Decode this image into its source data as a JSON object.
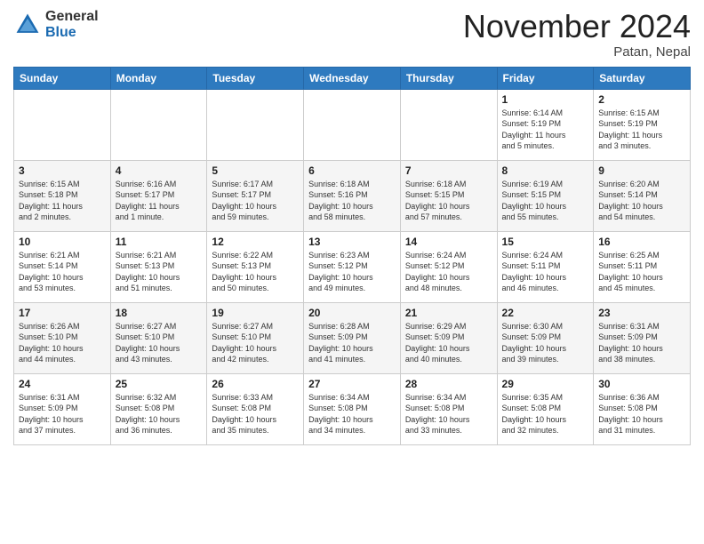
{
  "header": {
    "logo_general": "General",
    "logo_blue": "Blue",
    "month_title": "November 2024",
    "location": "Patan, Nepal"
  },
  "weekdays": [
    "Sunday",
    "Monday",
    "Tuesday",
    "Wednesday",
    "Thursday",
    "Friday",
    "Saturday"
  ],
  "weeks": [
    [
      {
        "day": "",
        "info": ""
      },
      {
        "day": "",
        "info": ""
      },
      {
        "day": "",
        "info": ""
      },
      {
        "day": "",
        "info": ""
      },
      {
        "day": "",
        "info": ""
      },
      {
        "day": "1",
        "info": "Sunrise: 6:14 AM\nSunset: 5:19 PM\nDaylight: 11 hours\nand 5 minutes."
      },
      {
        "day": "2",
        "info": "Sunrise: 6:15 AM\nSunset: 5:19 PM\nDaylight: 11 hours\nand 3 minutes."
      }
    ],
    [
      {
        "day": "3",
        "info": "Sunrise: 6:15 AM\nSunset: 5:18 PM\nDaylight: 11 hours\nand 2 minutes."
      },
      {
        "day": "4",
        "info": "Sunrise: 6:16 AM\nSunset: 5:17 PM\nDaylight: 11 hours\nand 1 minute."
      },
      {
        "day": "5",
        "info": "Sunrise: 6:17 AM\nSunset: 5:17 PM\nDaylight: 10 hours\nand 59 minutes."
      },
      {
        "day": "6",
        "info": "Sunrise: 6:18 AM\nSunset: 5:16 PM\nDaylight: 10 hours\nand 58 minutes."
      },
      {
        "day": "7",
        "info": "Sunrise: 6:18 AM\nSunset: 5:15 PM\nDaylight: 10 hours\nand 57 minutes."
      },
      {
        "day": "8",
        "info": "Sunrise: 6:19 AM\nSunset: 5:15 PM\nDaylight: 10 hours\nand 55 minutes."
      },
      {
        "day": "9",
        "info": "Sunrise: 6:20 AM\nSunset: 5:14 PM\nDaylight: 10 hours\nand 54 minutes."
      }
    ],
    [
      {
        "day": "10",
        "info": "Sunrise: 6:21 AM\nSunset: 5:14 PM\nDaylight: 10 hours\nand 53 minutes."
      },
      {
        "day": "11",
        "info": "Sunrise: 6:21 AM\nSunset: 5:13 PM\nDaylight: 10 hours\nand 51 minutes."
      },
      {
        "day": "12",
        "info": "Sunrise: 6:22 AM\nSunset: 5:13 PM\nDaylight: 10 hours\nand 50 minutes."
      },
      {
        "day": "13",
        "info": "Sunrise: 6:23 AM\nSunset: 5:12 PM\nDaylight: 10 hours\nand 49 minutes."
      },
      {
        "day": "14",
        "info": "Sunrise: 6:24 AM\nSunset: 5:12 PM\nDaylight: 10 hours\nand 48 minutes."
      },
      {
        "day": "15",
        "info": "Sunrise: 6:24 AM\nSunset: 5:11 PM\nDaylight: 10 hours\nand 46 minutes."
      },
      {
        "day": "16",
        "info": "Sunrise: 6:25 AM\nSunset: 5:11 PM\nDaylight: 10 hours\nand 45 minutes."
      }
    ],
    [
      {
        "day": "17",
        "info": "Sunrise: 6:26 AM\nSunset: 5:10 PM\nDaylight: 10 hours\nand 44 minutes."
      },
      {
        "day": "18",
        "info": "Sunrise: 6:27 AM\nSunset: 5:10 PM\nDaylight: 10 hours\nand 43 minutes."
      },
      {
        "day": "19",
        "info": "Sunrise: 6:27 AM\nSunset: 5:10 PM\nDaylight: 10 hours\nand 42 minutes."
      },
      {
        "day": "20",
        "info": "Sunrise: 6:28 AM\nSunset: 5:09 PM\nDaylight: 10 hours\nand 41 minutes."
      },
      {
        "day": "21",
        "info": "Sunrise: 6:29 AM\nSunset: 5:09 PM\nDaylight: 10 hours\nand 40 minutes."
      },
      {
        "day": "22",
        "info": "Sunrise: 6:30 AM\nSunset: 5:09 PM\nDaylight: 10 hours\nand 39 minutes."
      },
      {
        "day": "23",
        "info": "Sunrise: 6:31 AM\nSunset: 5:09 PM\nDaylight: 10 hours\nand 38 minutes."
      }
    ],
    [
      {
        "day": "24",
        "info": "Sunrise: 6:31 AM\nSunset: 5:09 PM\nDaylight: 10 hours\nand 37 minutes."
      },
      {
        "day": "25",
        "info": "Sunrise: 6:32 AM\nSunset: 5:08 PM\nDaylight: 10 hours\nand 36 minutes."
      },
      {
        "day": "26",
        "info": "Sunrise: 6:33 AM\nSunset: 5:08 PM\nDaylight: 10 hours\nand 35 minutes."
      },
      {
        "day": "27",
        "info": "Sunrise: 6:34 AM\nSunset: 5:08 PM\nDaylight: 10 hours\nand 34 minutes."
      },
      {
        "day": "28",
        "info": "Sunrise: 6:34 AM\nSunset: 5:08 PM\nDaylight: 10 hours\nand 33 minutes."
      },
      {
        "day": "29",
        "info": "Sunrise: 6:35 AM\nSunset: 5:08 PM\nDaylight: 10 hours\nand 32 minutes."
      },
      {
        "day": "30",
        "info": "Sunrise: 6:36 AM\nSunset: 5:08 PM\nDaylight: 10 hours\nand 31 minutes."
      }
    ]
  ]
}
